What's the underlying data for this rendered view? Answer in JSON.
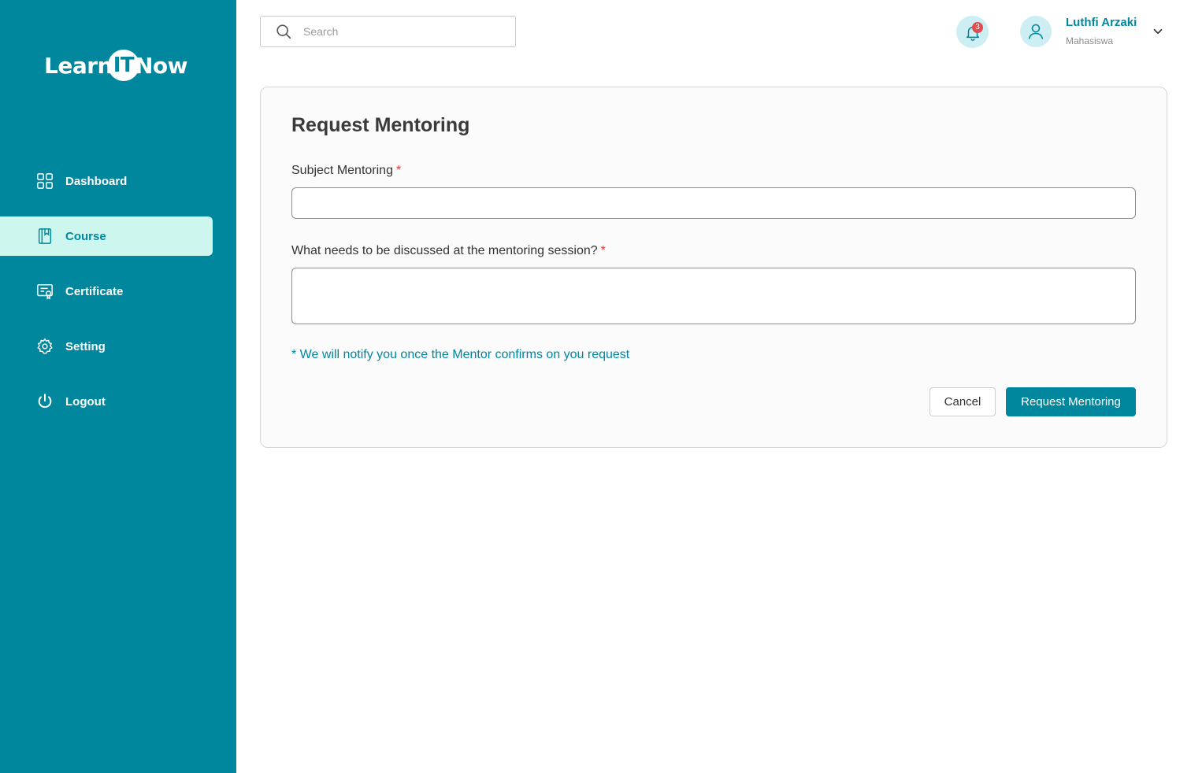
{
  "brand": {
    "logo_prefix": "Learn",
    "logo_badge": "IT",
    "logo_suffix": "Now"
  },
  "sidebar": {
    "items": [
      {
        "label": "Dashboard",
        "icon": "grid-icon",
        "active": false
      },
      {
        "label": "Course",
        "icon": "book-icon",
        "active": true
      },
      {
        "label": "Certificate",
        "icon": "certificate-icon",
        "active": false
      },
      {
        "label": "Setting",
        "icon": "gear-icon",
        "active": false
      },
      {
        "label": "Logout",
        "icon": "power-icon",
        "active": false
      }
    ]
  },
  "header": {
    "search": {
      "placeholder": "Search",
      "value": ""
    },
    "notifications": {
      "count": "3"
    },
    "user": {
      "name": "Luthfi Arzaki",
      "role": "Mahasiswa"
    }
  },
  "form": {
    "title": "Request Mentoring",
    "subject_label": "Subject Mentoring",
    "subject_required": "*",
    "subject_value": "",
    "discussion_label": "What needs to be discussed at the mentoring session?",
    "discussion_required": "*",
    "discussion_value": "",
    "note": "* We will notify you once the Mentor confirms on you request",
    "cancel_label": "Cancel",
    "submit_label": "Request Mentoring"
  },
  "colors": {
    "primary": "#00879e",
    "sidebar_active_bg": "#cdf7ee",
    "required": "#d93b3b",
    "notification_badge": "#e24c4c"
  }
}
